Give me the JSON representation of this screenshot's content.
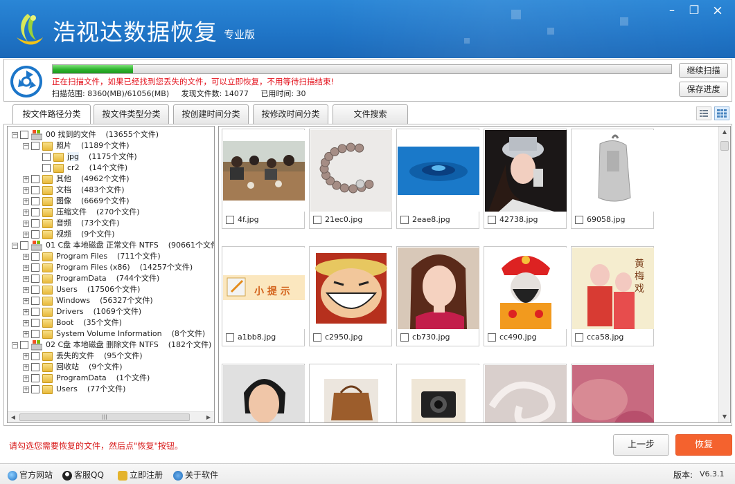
{
  "app": {
    "title": "浩视达数据恢复",
    "edition": "专业版"
  },
  "window_controls": {
    "minimize": "–",
    "maximize": "❐",
    "close": "×"
  },
  "scan": {
    "progress": 0.13,
    "message": "正在扫描文件，如果已经找到您丢失的文件，可以立即恢复，不用等待扫描结束!",
    "range": "扫描范围: 8360(MB)/61056(MB)",
    "found": "发现文件数: 14077",
    "elapsed": "已用时间: 30",
    "continue_label": "继续扫描",
    "save_label": "保存进度"
  },
  "tabs": [
    {
      "label": "按文件路径分类",
      "active": true
    },
    {
      "label": "按文件类型分类",
      "active": false
    },
    {
      "label": "按创建时间分类",
      "active": false
    },
    {
      "label": "按修改时间分类",
      "active": false
    },
    {
      "label": "文件搜索",
      "active": false
    }
  ],
  "tree": [
    {
      "label": "00 找到的文件",
      "count": "(13655个文件)",
      "level": 0,
      "type": "drive",
      "expand": "−"
    },
    {
      "label": "照片",
      "count": "(1189个文件)",
      "level": 1,
      "type": "folder",
      "expand": "−"
    },
    {
      "label": "jpg",
      "count": "(1175个文件)",
      "level": 2,
      "type": "folder",
      "expand": "",
      "selected": true
    },
    {
      "label": "cr2",
      "count": "(14个文件)",
      "level": 2,
      "type": "folder",
      "expand": ""
    },
    {
      "label": "其他",
      "count": "(4962个文件)",
      "level": 1,
      "type": "folder",
      "expand": "+"
    },
    {
      "label": "文档",
      "count": "(483个文件)",
      "level": 1,
      "type": "folder",
      "expand": "+"
    },
    {
      "label": "图像",
      "count": "(6669个文件)",
      "level": 1,
      "type": "folder",
      "expand": "+"
    },
    {
      "label": "压缩文件",
      "count": "(270个文件)",
      "level": 1,
      "type": "folder",
      "expand": "+"
    },
    {
      "label": "音频",
      "count": "(73个文件)",
      "level": 1,
      "type": "folder",
      "expand": "+"
    },
    {
      "label": "视频",
      "count": "(9个文件)",
      "level": 1,
      "type": "folder",
      "expand": "+"
    },
    {
      "label": "01 C盘 本地磁盘 正常文件 NTFS",
      "count": "(90661个文件",
      "level": 0,
      "type": "drive",
      "expand": "−"
    },
    {
      "label": "Program Files",
      "count": "(711个文件)",
      "level": 1,
      "type": "folder",
      "expand": "+"
    },
    {
      "label": "Program Files (x86)",
      "count": "(14257个文件)",
      "level": 1,
      "type": "folder",
      "expand": "+"
    },
    {
      "label": "ProgramData",
      "count": "(744个文件)",
      "level": 1,
      "type": "folder",
      "expand": "+"
    },
    {
      "label": "Users",
      "count": "(17506个文件)",
      "level": 1,
      "type": "folder",
      "expand": "+"
    },
    {
      "label": "Windows",
      "count": "(56327个文件)",
      "level": 1,
      "type": "folder",
      "expand": "+"
    },
    {
      "label": "Drivers",
      "count": "(1069个文件)",
      "level": 1,
      "type": "folder",
      "expand": "+"
    },
    {
      "label": "Boot",
      "count": "(35个文件)",
      "level": 1,
      "type": "folder",
      "expand": "+"
    },
    {
      "label": "System Volume Information",
      "count": "(8个文件)",
      "level": 1,
      "type": "folder",
      "expand": "+"
    },
    {
      "label": "02 C盘 本地磁盘 删除文件 NTFS",
      "count": "(182个文件)",
      "level": 0,
      "type": "drive",
      "expand": "−"
    },
    {
      "label": "丢失的文件",
      "count": "(95个文件)",
      "level": 1,
      "type": "folder",
      "expand": "+"
    },
    {
      "label": "回收站",
      "count": "(9个文件)",
      "level": 1,
      "type": "folder",
      "expand": "+"
    },
    {
      "label": "ProgramData",
      "count": "(1个文件)",
      "level": 1,
      "type": "folder",
      "expand": "+"
    },
    {
      "label": "Users",
      "count": "(77个文件)",
      "level": 1,
      "type": "folder",
      "expand": "+"
    }
  ],
  "files": [
    {
      "name": "4f.jpg",
      "thumb": "restaurant"
    },
    {
      "name": "21ec0.jpg",
      "thumb": "bracelet"
    },
    {
      "name": "2eae8.jpg",
      "thumb": "water"
    },
    {
      "name": "42738.jpg",
      "thumb": "singer"
    },
    {
      "name": "69058.jpg",
      "thumb": "backpack"
    },
    {
      "name": "a1bb8.jpg",
      "thumb": "tip",
      "thumb_text": "小 提 示"
    },
    {
      "name": "c2950.jpg",
      "thumb": "cartoon"
    },
    {
      "name": "cb730.jpg",
      "thumb": "woman"
    },
    {
      "name": "cc490.jpg",
      "thumb": "opera"
    },
    {
      "name": "cca58.jpg",
      "thumb": "poster",
      "thumb_text": "黄梅戏"
    },
    {
      "name": "",
      "thumb": "portrait"
    },
    {
      "name": "",
      "thumb": "bag"
    },
    {
      "name": "",
      "thumb": "camera"
    },
    {
      "name": "",
      "thumb": "swirl"
    },
    {
      "name": "",
      "thumb": "pink"
    }
  ],
  "bottom": {
    "hint": "请勾选您需要恢复的文件，然后点\"恢复\"按钮。",
    "prev_label": "上一步",
    "recover_label": "恢复"
  },
  "footer": {
    "links": [
      "官方网站",
      "客服QQ",
      "立即注册",
      "关于软件"
    ],
    "version_label": "版本:",
    "version": "V6.3.1"
  },
  "colors": {
    "titlebar": "#1f74c6",
    "progress": "#2cb22c",
    "alert": "#e3101b",
    "recover": "#f4622e"
  }
}
